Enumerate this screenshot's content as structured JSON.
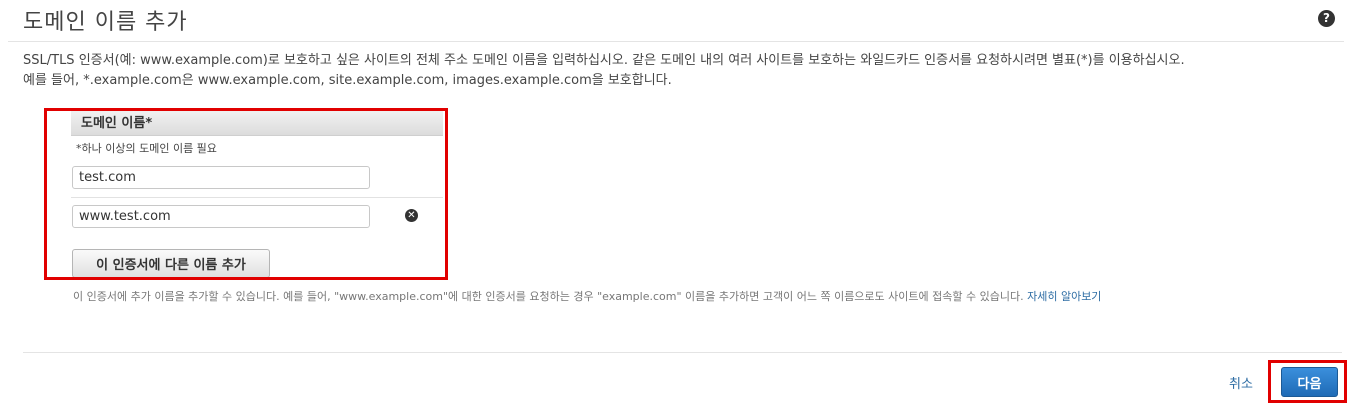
{
  "header": {
    "title": "도메인 이름 추가",
    "help_icon_glyph": "?"
  },
  "description": {
    "line1": "SSL/TLS 인증서(예: www.example.com)로 보호하고 싶은 사이트의 전체 주소 도메인 이름을 입력하십시오. 같은 도메인 내의 여러 사이트를 보호하는 와일드카드 인증서를 요청하시려면 별표(*)를 이용하십시오.",
    "line2": "예를 들어, *.example.com은 www.example.com, site.example.com, images.example.com을 보호합니다."
  },
  "domain_form": {
    "column_header": "도메인 이름*",
    "required_note": "*하나 이상의 도메인 이름 필요",
    "entries": [
      {
        "value": "test.com",
        "removable": false
      },
      {
        "value": "www.test.com",
        "removable": true
      }
    ],
    "remove_icon_glyph": "✕",
    "add_button_label": "이 인증서에 다른 이름 추가"
  },
  "hint": {
    "text": "이 인증서에 추가 이름을 추가할 수 있습니다. 예를 들어, \"www.example.com\"에 대한 인증서를 요청하는 경우 \"example.com\" 이름을 추가하면 고객이 어느 쪽 이름으로도 사이트에 접속할 수 있습니다.",
    "link_text": "자세히 알아보기"
  },
  "footer": {
    "cancel_label": "취소",
    "next_label": "다음"
  },
  "colors": {
    "highlight": "#e10000",
    "primary_button": "#1f6bb6",
    "link": "#2e6da4"
  }
}
